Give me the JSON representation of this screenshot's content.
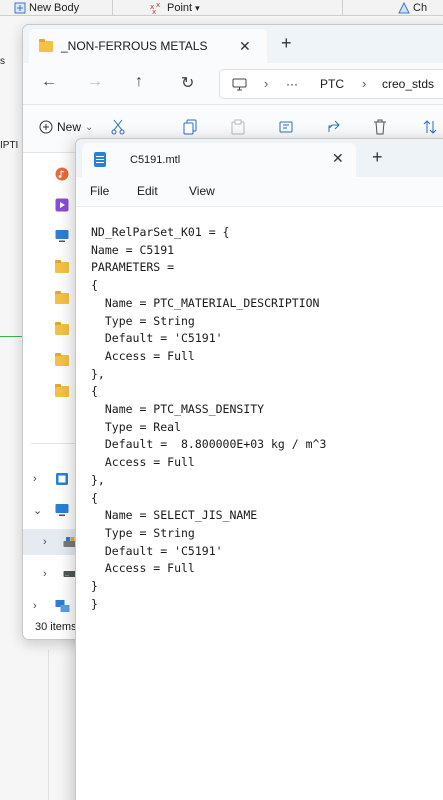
{
  "cad": {
    "toolbar": {
      "new_body": "New Body",
      "point": "Point",
      "point_caret": "▾",
      "cut_off": "Ch"
    },
    "left_labels": [
      "s",
      "IPTI"
    ]
  },
  "explorer": {
    "tab_title": "_NON-FERROUS METALS",
    "tab_close": "✕",
    "new_tab": "+",
    "nav": {
      "back": "←",
      "forward": "→",
      "up": "↑",
      "refresh": "↻"
    },
    "address": {
      "more": "···",
      "crumbs": [
        "PTC",
        "creo_stds"
      ],
      "separator": "›"
    },
    "commands": {
      "new_label": "New",
      "new_caret": "⌄"
    },
    "status": "30 items"
  },
  "notepad": {
    "tab_title": "C5191.mtl",
    "tab_close": "✕",
    "new_tab": "+",
    "menus": [
      "File",
      "Edit",
      "View"
    ],
    "content": [
      "ND_RelParSet_K01 = {",
      "Name = C5191",
      "PARAMETERS =",
      "{",
      "  Name = PTC_MATERIAL_DESCRIPTION",
      "  Type = String",
      "  Default = 'C5191'",
      "  Access = Full",
      "},",
      "{",
      "  Name = PTC_MASS_DENSITY",
      "  Type = Real",
      "  Default =  8.800000E+03 kg / m^3",
      "  Access = Full",
      "},",
      "{",
      "  Name = SELECT_JIS_NAME",
      "  Type = String",
      "  Default = 'C5191'",
      "  Access = Full",
      "}",
      "}"
    ]
  },
  "colors": {
    "accent_blue": "#2b7fd6",
    "folder_yellow": "#f3c244",
    "cad_green": "#39b54a"
  }
}
